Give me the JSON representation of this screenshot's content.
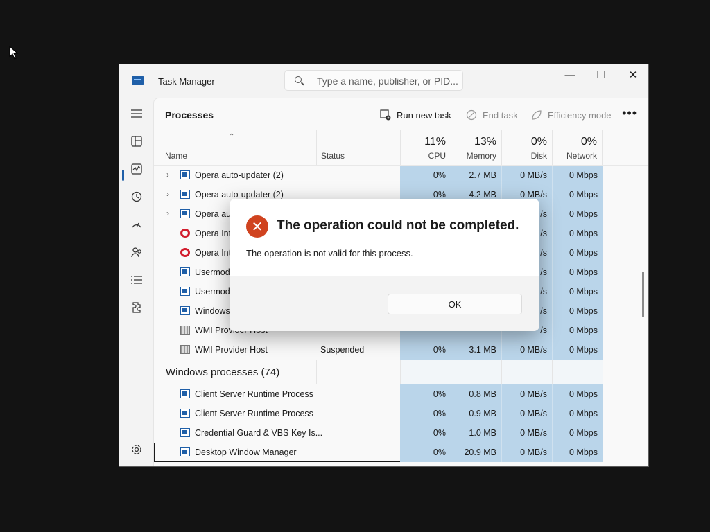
{
  "app": {
    "title": "Task Manager",
    "search_placeholder": "Type a name, publisher, or PID...",
    "window_controls": {
      "minimize": "—",
      "maximize": "☐",
      "close": "✕"
    }
  },
  "rail": {
    "icons": [
      "hamburger-menu-icon",
      "processes-icon",
      "performance-icon",
      "app-history-icon",
      "startup-apps-icon",
      "users-icon",
      "details-icon",
      "services-icon",
      "settings-icon"
    ],
    "active": "processes-icon"
  },
  "toolbar": {
    "page_title": "Processes",
    "run_new_task": "Run new task",
    "end_task": "End task",
    "efficiency_mode": "Efficiency mode",
    "more": "•••"
  },
  "columns": {
    "name": "Name",
    "status": "Status",
    "cpu": {
      "pct": "11%",
      "label": "CPU"
    },
    "memory": {
      "pct": "13%",
      "label": "Memory"
    },
    "disk": {
      "pct": "0%",
      "label": "Disk"
    },
    "network": {
      "pct": "0%",
      "label": "Network"
    }
  },
  "rows": [
    {
      "expand": "›",
      "icon": "proc",
      "name": "Opera auto-updater (2)",
      "status": "",
      "cpu": "0%",
      "mem": "2.7 MB",
      "disk": "0 MB/s",
      "net": "0 Mbps"
    },
    {
      "expand": "›",
      "icon": "proc",
      "name": "Opera auto-updater (2)",
      "status": "",
      "cpu": "0%",
      "mem": "4.2 MB",
      "disk": "0 MB/s",
      "net": "0 Mbps"
    },
    {
      "expand": "›",
      "icon": "proc",
      "name": "Opera aut",
      "status": "",
      "cpu": "",
      "mem": "",
      "disk": "/s",
      "net": "0 Mbps"
    },
    {
      "expand": "",
      "icon": "opera",
      "name": "Opera Inte",
      "status": "",
      "cpu": "",
      "mem": "",
      "disk": "/s",
      "net": "0 Mbps"
    },
    {
      "expand": "",
      "icon": "opera",
      "name": "Opera Inte",
      "status": "",
      "cpu": "",
      "mem": "",
      "disk": "/s",
      "net": "0 Mbps"
    },
    {
      "expand": "",
      "icon": "proc",
      "name": "Usermode",
      "status": "",
      "cpu": "",
      "mem": "",
      "disk": "/s",
      "net": "0 Mbps"
    },
    {
      "expand": "",
      "icon": "proc",
      "name": "Usermode",
      "status": "",
      "cpu": "",
      "mem": "",
      "disk": "/s",
      "net": "0 Mbps"
    },
    {
      "expand": "",
      "icon": "proc",
      "name": "Windows",
      "status": "",
      "cpu": "",
      "mem": "",
      "disk": "/s",
      "net": "0 Mbps"
    },
    {
      "expand": "",
      "icon": "wmi",
      "name": "WMI Provider Host",
      "status": "",
      "cpu": "",
      "mem": "",
      "disk": "/s",
      "net": "0 Mbps"
    },
    {
      "expand": "",
      "icon": "wmi",
      "name": "WMI Provider Host",
      "status": "Suspended",
      "cpu": "0%",
      "mem": "3.1 MB",
      "disk": "0 MB/s",
      "net": "0 Mbps"
    }
  ],
  "group": {
    "label": "Windows processes (74)"
  },
  "windows_rows": [
    {
      "icon": "proc",
      "name": "Client Server Runtime Process",
      "status": "",
      "cpu": "0%",
      "mem": "0.8 MB",
      "disk": "0 MB/s",
      "net": "0 Mbps"
    },
    {
      "icon": "proc",
      "name": "Client Server Runtime Process",
      "status": "",
      "cpu": "0%",
      "mem": "0.9 MB",
      "disk": "0 MB/s",
      "net": "0 Mbps"
    },
    {
      "icon": "proc",
      "name": "Credential Guard & VBS Key Is...",
      "status": "",
      "cpu": "0%",
      "mem": "1.0 MB",
      "disk": "0 MB/s",
      "net": "0 Mbps"
    },
    {
      "icon": "proc",
      "name": "Desktop Window Manager",
      "status": "",
      "cpu": "0%",
      "mem": "20.9 MB",
      "disk": "0 MB/s",
      "net": "0 Mbps",
      "selected": true
    }
  ],
  "dialog": {
    "title": "The operation could not be completed.",
    "message": "The operation is not valid for this process.",
    "ok": "OK",
    "icon": "error-icon"
  }
}
